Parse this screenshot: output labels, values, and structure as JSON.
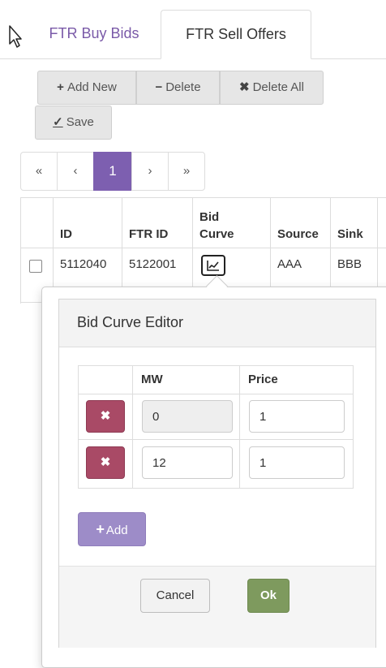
{
  "tabs": [
    {
      "label": "FTR Buy Bids",
      "active": false
    },
    {
      "label": "FTR Sell Offers",
      "active": true
    }
  ],
  "toolbar": {
    "add_new": {
      "icon": "+",
      "label": "Add New"
    },
    "delete": {
      "icon": "−",
      "label": "Delete"
    },
    "delete_all": {
      "icon": "✖",
      "label": "Delete All"
    },
    "save": {
      "icon": "✓",
      "label": "Save"
    }
  },
  "pagination": {
    "first": "«",
    "prev": "‹",
    "current": "1",
    "next": "›",
    "last": "»"
  },
  "grid": {
    "headers": {
      "id": "ID",
      "ftr_id": "FTR ID",
      "bid_curve": "Bid Curve",
      "source": "Source",
      "sink": "Sink"
    },
    "rows": [
      {
        "id": "5112040",
        "ftr_id": "5122001",
        "source": "AAA",
        "sink": "BBB",
        "checked": false
      }
    ]
  },
  "editor": {
    "title": "Bid Curve Editor",
    "headers": {
      "mw": "MW",
      "price": "Price"
    },
    "remove_icon": "✖",
    "rows": [
      {
        "mw": "0",
        "price": "1",
        "mw_readonly": true
      },
      {
        "mw": "12",
        "price": "1",
        "mw_readonly": false
      }
    ],
    "add_icon": "+",
    "add_label": "Add",
    "cancel_label": "Cancel",
    "ok_label": "Ok"
  },
  "colors": {
    "accent": "#7d5fb0",
    "remove": "#a94a66",
    "add": "#9d8cc8",
    "ok": "#7e9a5e"
  }
}
